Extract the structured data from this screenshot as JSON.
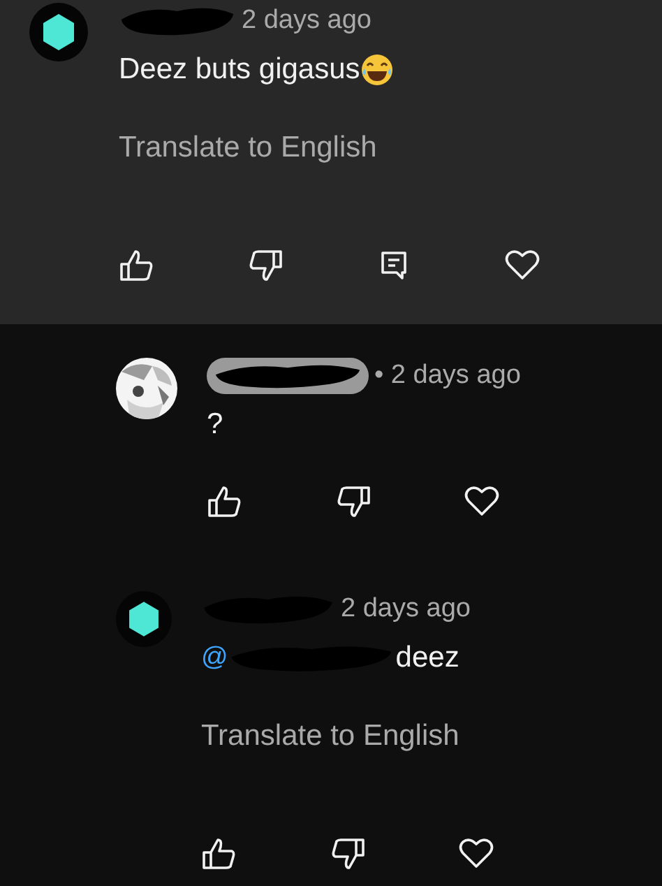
{
  "comments": [
    {
      "kind": "top",
      "avatar": {
        "kind": "hexagon"
      },
      "name_badge": false,
      "time": "2 days ago",
      "text": "Deez buts gigasus",
      "emoji": true,
      "translate": "Translate to English",
      "actions": [
        {
          "kind": "like"
        },
        {
          "kind": "dislike"
        },
        {
          "kind": "reply"
        },
        {
          "kind": "heart"
        }
      ]
    },
    {
      "kind": "reply",
      "avatar": {
        "kind": "picture"
      },
      "name_badge": true,
      "time": "• 2 days ago",
      "text": "?",
      "emoji": false,
      "actions": [
        {
          "kind": "like"
        },
        {
          "kind": "dislike"
        },
        {
          "kind": "heart"
        }
      ]
    },
    {
      "kind": "reply",
      "avatar": {
        "kind": "hexagon"
      },
      "name_badge": false,
      "time": "2 days ago",
      "mention": "@",
      "text": "deez",
      "emoji": false,
      "translate": "Translate to English",
      "actions": [
        {
          "kind": "like"
        },
        {
          "kind": "dislike"
        },
        {
          "kind": "heart"
        }
      ]
    }
  ]
}
